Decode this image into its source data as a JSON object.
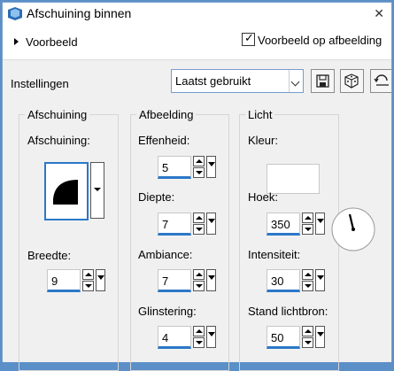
{
  "window": {
    "title": "Afschuining binnen"
  },
  "preview": {
    "label": "Voorbeeld",
    "checkbox_label": "Voorbeeld op afbeelding",
    "checked": true
  },
  "settings": {
    "label": "Instellingen",
    "preset_value": "Laatst gebruikt"
  },
  "groups": {
    "bevel": {
      "title": "Afschuining",
      "shape_label": "Afschuining:",
      "width_label": "Breedte:",
      "width_value": "9"
    },
    "image": {
      "title": "Afbeelding",
      "smoothness_label": "Effenheid:",
      "smoothness_value": "5",
      "depth_label": "Diepte:",
      "depth_value": "7",
      "ambience_label": "Ambiance:",
      "ambience_value": "7",
      "shininess_label": "Glinstering:",
      "shininess_value": "4"
    },
    "light": {
      "title": "Licht",
      "color_label": "Kleur:",
      "color_value": "#ffffff",
      "angle_label": "Hoek:",
      "angle_value": "350",
      "intensity_label": "Intensiteit:",
      "intensity_value": "30",
      "elevation_label": "Stand lichtbron:",
      "elevation_value": "50"
    }
  },
  "icons": [
    "app-icon",
    "close-icon",
    "expand-arrow-icon",
    "checkmark-icon",
    "dropdown-arrow-icon",
    "save-icon",
    "dice-icon",
    "reset-icon",
    "bevel-shape-icon",
    "angle-dial-icon"
  ]
}
